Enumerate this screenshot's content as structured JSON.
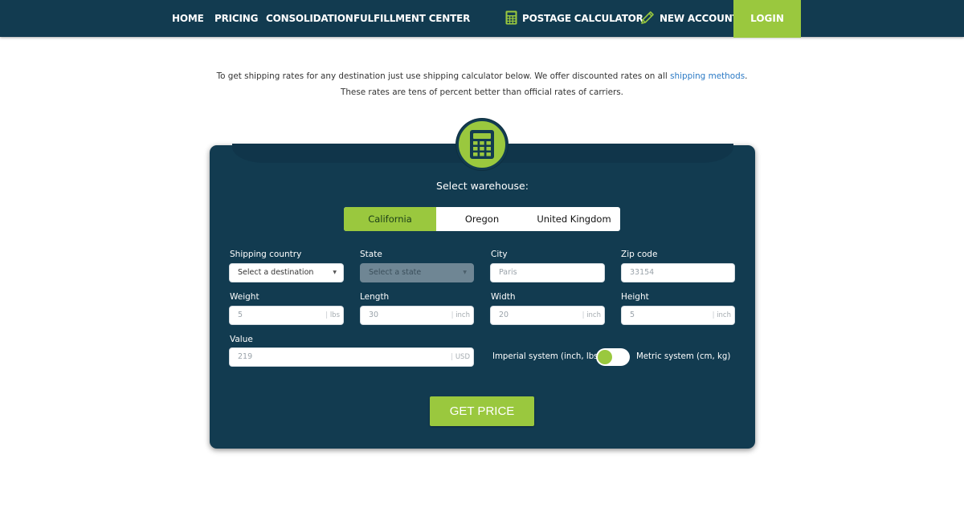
{
  "nav": {
    "items": [
      "HOME",
      "PRICING",
      "CONSOLIDATION",
      "FULFILLMENT CENTER"
    ],
    "postage_calculator": "POSTAGE CALCULATOR",
    "new_account": "NEW ACCOUNT",
    "login": "LOGIN"
  },
  "intro": {
    "text_before": "To get shipping rates for any destination just use shipping calculator below. We offer discounted rates on all ",
    "link": "shipping methods",
    "text_after": ". These rates are tens of percent better than official rates of carriers."
  },
  "calculator": {
    "icon": "calculator-icon",
    "warehouse_title": "Select warehouse:",
    "warehouses": [
      "California",
      "Oregon",
      "United Kingdom"
    ],
    "selected_warehouse": "California",
    "fields": {
      "shipping_country": {
        "label": "Shipping country",
        "value": "Select a destination"
      },
      "state": {
        "label": "State",
        "value": "Select a state"
      },
      "city": {
        "label": "City",
        "placeholder": "Paris"
      },
      "zip": {
        "label": "Zip code",
        "placeholder": "33154"
      },
      "weight": {
        "label": "Weight",
        "placeholder": "5",
        "unit": "lbs"
      },
      "length": {
        "label": "Length",
        "placeholder": "30",
        "unit": "inch"
      },
      "width": {
        "label": "Width",
        "placeholder": "20",
        "unit": "inch"
      },
      "height": {
        "label": "Height",
        "placeholder": "5",
        "unit": "inch"
      },
      "value": {
        "label": "Value",
        "placeholder": "219",
        "unit": "USD"
      }
    },
    "unit_system": {
      "imperial": "Imperial system (inch, lbs)",
      "metric": "Metric system (cm, kg)",
      "selected": "imperial"
    },
    "submit": "GET PRICE"
  },
  "colors": {
    "navy": "#123b50",
    "accent_green": "#9ac83e",
    "link_blue": "#2b7ac5"
  }
}
